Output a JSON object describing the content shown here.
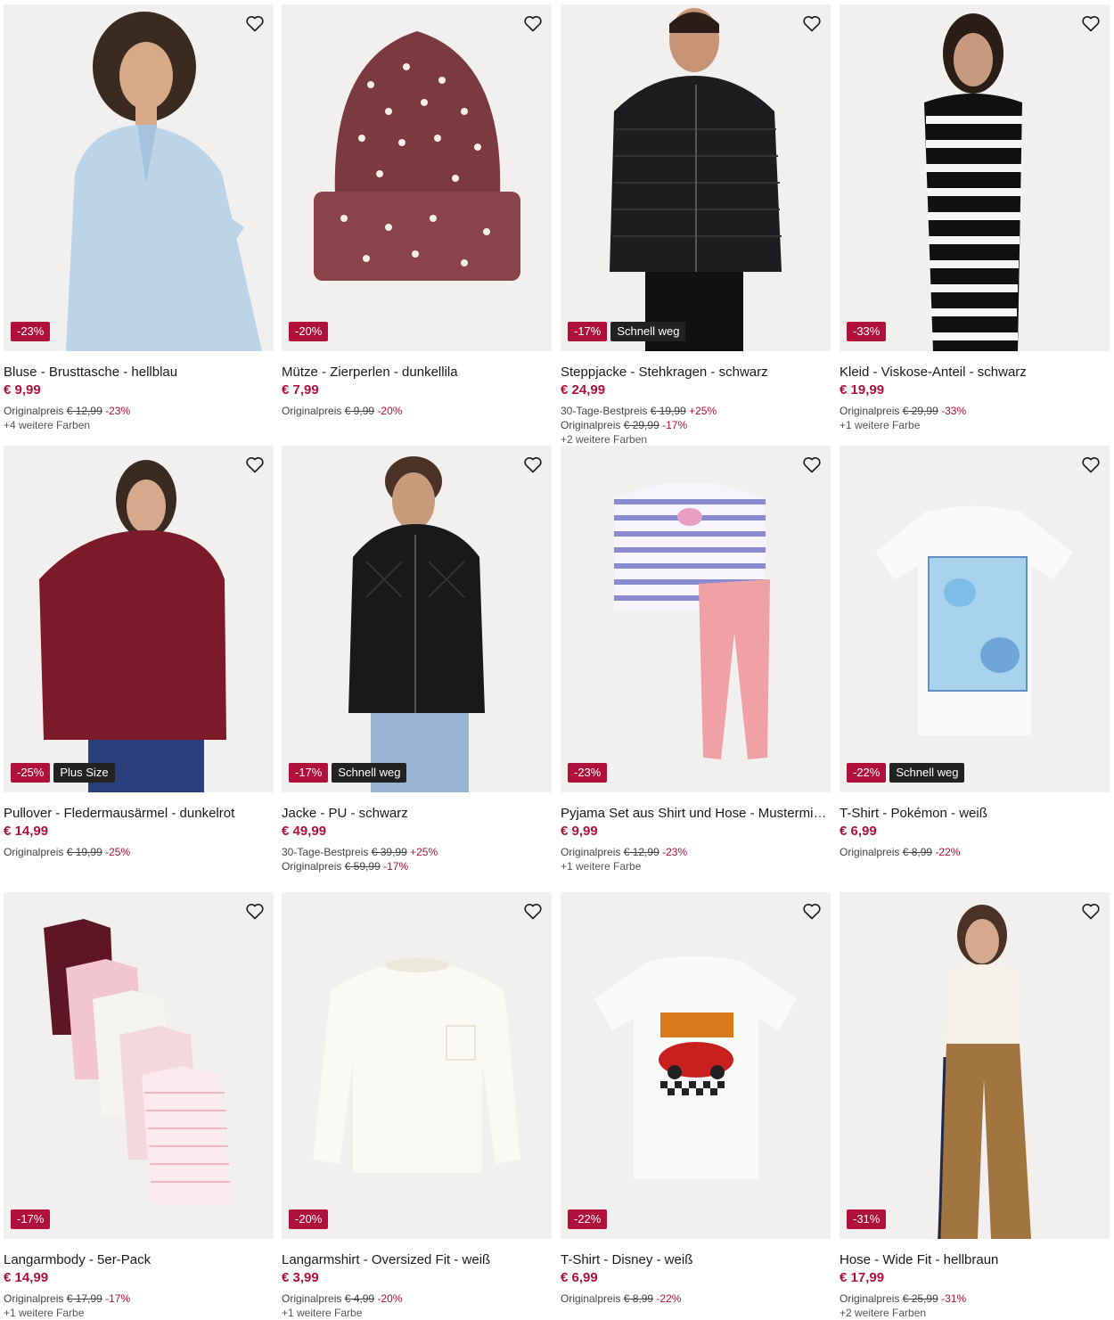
{
  "colors": {
    "sale": "#b0103c",
    "flag": "#222222",
    "price": "#b0103c"
  },
  "products": [
    {
      "image": "woman-light-blue-blouse",
      "badges": [
        {
          "text": "-23%",
          "type": "sale"
        }
      ],
      "title": "Bluse - Brusttasche - hellblau",
      "price": "€ 9,99",
      "lines": [
        {
          "label": "Originalpreis",
          "old": "€ 12,99",
          "pct": "-23%"
        }
      ],
      "colors_note": "+4 weitere Farben"
    },
    {
      "image": "dark-lilac-beanie-with-pearls",
      "badges": [
        {
          "text": "-20%",
          "type": "sale"
        }
      ],
      "title": "Mütze - Zierperlen - dunkellila",
      "price": "€ 7,99",
      "lines": [
        {
          "label": "Originalpreis",
          "old": "€ 9,99",
          "pct": "-20%"
        }
      ],
      "colors_note": ""
    },
    {
      "image": "man-black-puffer-jacket",
      "badges": [
        {
          "text": "-17%",
          "type": "sale"
        },
        {
          "text": "Schnell weg",
          "type": "flag"
        }
      ],
      "title": "Steppjacke - Stehkragen - schwarz",
      "price": "€ 24,99",
      "lines": [
        {
          "label": "30-Tage-Bestpreis",
          "old": "€ 19,99",
          "pct": "+25%"
        },
        {
          "label": "Originalpreis",
          "old": "€ 29,99",
          "pct": "-17%"
        }
      ],
      "colors_note": "+2 weitere Farben"
    },
    {
      "image": "woman-black-white-striped-dress",
      "badges": [
        {
          "text": "-33%",
          "type": "sale"
        }
      ],
      "title": "Kleid - Viskose-Anteil - schwarz",
      "price": "€ 19,99",
      "lines": [
        {
          "label": "Originalpreis",
          "old": "€ 29,99",
          "pct": "-33%"
        }
      ],
      "colors_note": "+1 weitere Farbe"
    },
    {
      "image": "woman-dark-red-sweater",
      "badges": [
        {
          "text": "-25%",
          "type": "sale"
        },
        {
          "text": "Plus Size",
          "type": "flag"
        }
      ],
      "title": "Pullover - Fledermausärmel - dunkelrot",
      "price": "€ 14,99",
      "lines": [
        {
          "label": "Originalpreis",
          "old": "€ 19,99",
          "pct": "-25%"
        }
      ],
      "colors_note": ""
    },
    {
      "image": "man-black-leather-jacket",
      "badges": [
        {
          "text": "-17%",
          "type": "sale"
        },
        {
          "text": "Schnell weg",
          "type": "flag"
        }
      ],
      "title": "Jacke - PU - schwarz",
      "price": "€ 49,99",
      "lines": [
        {
          "label": "30-Tage-Bestpreis",
          "old": "€ 39,99",
          "pct": "+25%"
        },
        {
          "label": "Originalpreis",
          "old": "€ 59,99",
          "pct": "-17%"
        }
      ],
      "colors_note": ""
    },
    {
      "image": "kids-striped-pyjama-set",
      "badges": [
        {
          "text": "-23%",
          "type": "sale"
        }
      ],
      "title": "Pyjama Set aus Shirt und Hose - Mustermix...",
      "price": "€ 9,99",
      "lines": [
        {
          "label": "Originalpreis",
          "old": "€ 12,99",
          "pct": "-23%"
        }
      ],
      "colors_note": "+1 weitere Farbe"
    },
    {
      "image": "white-pokemon-tshirt",
      "badges": [
        {
          "text": "-22%",
          "type": "sale"
        },
        {
          "text": "Schnell weg",
          "type": "flag"
        }
      ],
      "title": "T-Shirt - Pokémon - weiß",
      "price": "€ 6,99",
      "lines": [
        {
          "label": "Originalpreis",
          "old": "€ 8,99",
          "pct": "-22%"
        }
      ],
      "colors_note": ""
    },
    {
      "image": "baby-bodysuits-5-pack",
      "badges": [
        {
          "text": "-17%",
          "type": "sale"
        }
      ],
      "title": "Langarmbody - 5er-Pack",
      "price": "€ 14,99",
      "lines": [
        {
          "label": "Originalpreis",
          "old": "€ 17,99",
          "pct": "-17%"
        }
      ],
      "colors_note": "+1 weitere Farbe"
    },
    {
      "image": "white-oversized-longsleeve",
      "badges": [
        {
          "text": "-20%",
          "type": "sale"
        }
      ],
      "title": "Langarmshirt - Oversized Fit - weiß",
      "price": "€ 3,99",
      "lines": [
        {
          "label": "Originalpreis",
          "old": "€ 4,99",
          "pct": "-20%"
        }
      ],
      "colors_note": "+1 weitere Farbe"
    },
    {
      "image": "white-disney-cars-tshirt",
      "badges": [
        {
          "text": "-22%",
          "type": "sale"
        }
      ],
      "title": "T-Shirt - Disney - weiß",
      "price": "€ 6,99",
      "lines": [
        {
          "label": "Originalpreis",
          "old": "€ 8,99",
          "pct": "-22%"
        }
      ],
      "colors_note": ""
    },
    {
      "image": "woman-light-brown-wide-pants",
      "badges": [
        {
          "text": "-31%",
          "type": "sale"
        }
      ],
      "title": "Hose - Wide Fit - hellbraun",
      "price": "€ 17,99",
      "lines": [
        {
          "label": "Originalpreis",
          "old": "€ 25,99",
          "pct": "-31%"
        }
      ],
      "colors_note": "+2 weitere Farben"
    }
  ]
}
